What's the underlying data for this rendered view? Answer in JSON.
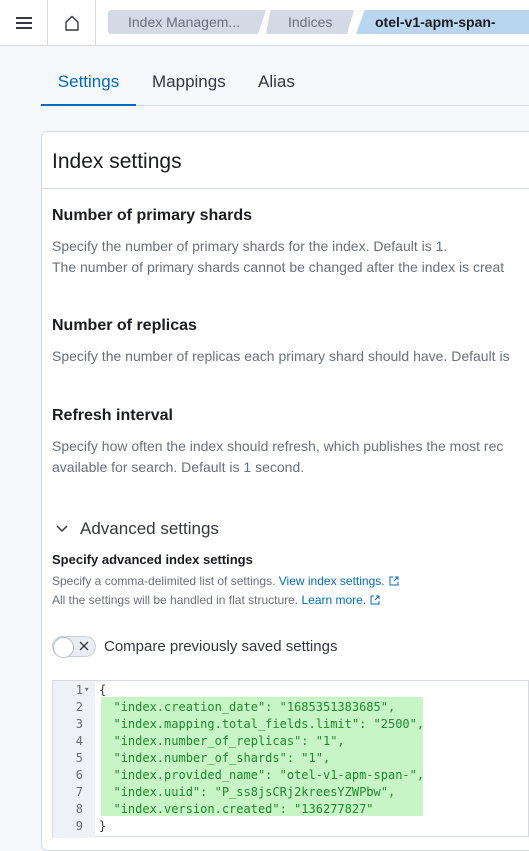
{
  "header": {
    "breadcrumbs": [
      "Index Managem...",
      "Indices",
      "otel-v1-apm-span-"
    ]
  },
  "tabs": [
    "Settings",
    "Mappings",
    "Alias"
  ],
  "panel": {
    "title": "Index settings",
    "fields": [
      {
        "title": "Number of primary shards",
        "desc1": "Specify the number of primary shards for the index. Default is 1.",
        "desc2": "The number of primary shards cannot be changed after the index is creat"
      },
      {
        "title": "Number of replicas",
        "desc1": "Specify the number of replicas each primary shard should have. Default is"
      },
      {
        "title": "Refresh interval",
        "desc1": "Specify how often the index should refresh, which publishes the most rec",
        "desc2": "available for search. Default is 1 second."
      }
    ],
    "advanced": {
      "label": "Advanced settings",
      "subtitle": "Specify advanced index settings",
      "desc1_text": "Specify a comma-delimited list of settings. ",
      "desc1_link": "View index settings.",
      "desc2_text": "All the settings will be handled in flat structure. ",
      "desc2_link": "Learn more.",
      "compare_label": "Compare previously saved settings"
    }
  },
  "editor": {
    "lines": [
      {
        "n": "1",
        "text": "{"
      },
      {
        "n": "2",
        "text": "  \"index.creation_date\": \"1685351383685\","
      },
      {
        "n": "3",
        "text": "  \"index.mapping.total_fields.limit\": \"2500\","
      },
      {
        "n": "4",
        "text": "  \"index.number_of_replicas\": \"1\","
      },
      {
        "n": "5",
        "text": "  \"index.number_of_shards\": \"1\","
      },
      {
        "n": "6",
        "text": "  \"index.provided_name\": \"otel-v1-apm-span-\","
      },
      {
        "n": "7",
        "text": "  \"index.uuid\": \"P_ss8jsCRj2kreesYZWPbw\","
      },
      {
        "n": "8",
        "text": "  \"index.version.created\": \"136277827\""
      },
      {
        "n": "9",
        "text": "}"
      }
    ]
  },
  "colors": {
    "accent": "#006bb8",
    "highlight": "#c7f5c6"
  }
}
